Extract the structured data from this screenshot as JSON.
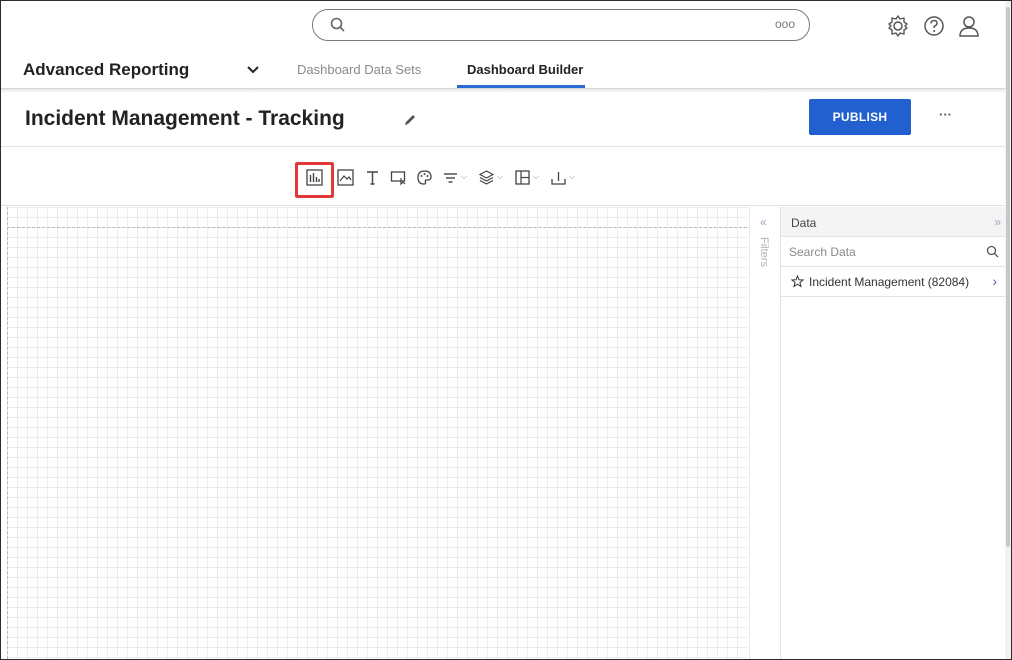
{
  "topbar": {
    "search_dots": "ooo",
    "icons": [
      "search-icon",
      "settings-gear-icon",
      "help-icon",
      "user-profile-icon"
    ]
  },
  "appnav": {
    "app_title": "Advanced Reporting",
    "tabs": [
      {
        "label": "Dashboard Data Sets",
        "active": false
      },
      {
        "label": "Dashboard Builder",
        "active": true
      }
    ]
  },
  "page": {
    "title": "Incident Management - Tracking",
    "publish_label": "PUBLISH",
    "more_label": "···"
  },
  "toolbar": {
    "tools": [
      "chart-widget-icon",
      "image-widget-icon",
      "text-widget-icon",
      "embed-widget-icon",
      "palette-icon",
      "filter-icon",
      "layers-icon",
      "layout-icon",
      "export-icon"
    ],
    "highlighted": "chart-widget-icon"
  },
  "filters": {
    "label": "Filters",
    "chevron": "«"
  },
  "data_panel": {
    "title": "Data",
    "collapse": "»",
    "search_placeholder": "Search Data",
    "items": [
      {
        "label": "Incident Management (82084)",
        "chevron": "›"
      }
    ]
  },
  "colors": {
    "accent": "#2260d0",
    "highlight": "#e23a3a"
  }
}
